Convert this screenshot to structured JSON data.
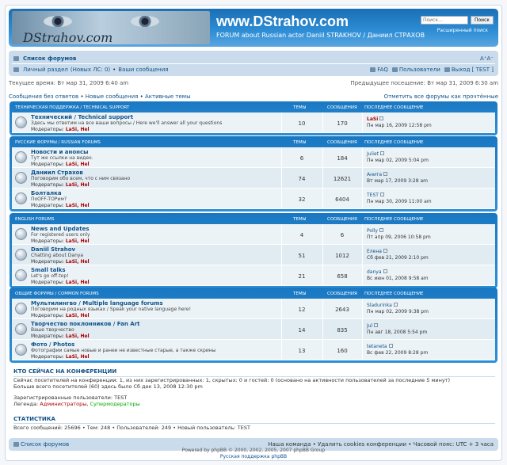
{
  "header": {
    "logo_text": "DStrahov.com",
    "site_name": "www.DStrahov.com",
    "site_desc": "FORUM about Russian actor Daniil STRAKHOV / Даниил СТРАХОВ",
    "search_placeholder": "Поиск…",
    "search_button": "Поиск",
    "advanced_search": "Расширенный поиск"
  },
  "navbar": {
    "forum_index": "Список форумов",
    "fontsize": "A⁺A⁻",
    "ucp": "Личный раздел",
    "pm": "(Новых ЛС: 0)",
    "pm_sep": "•",
    "own_posts": "Ваши сообщения",
    "faq": "FAQ",
    "members": "Пользователи",
    "logout": "Выход [ TEST ]"
  },
  "time": {
    "current": "Текущее время: Вт мар 31, 2009 6:40 am",
    "last_visit": "Предыдущее посещение: Вт мар 31, 2009 6:30 am"
  },
  "links": {
    "unanswered": "Сообщения без ответов",
    "sep": "•",
    "new_posts": "Новые сообщения",
    "active": "Активные темы",
    "mark_read": "Отметить все форумы как прочтённые"
  },
  "col_headers": {
    "topics": "ТЕМЫ",
    "posts": "СООБЩЕНИЯ",
    "last_post": "ПОСЛЕДНЕЕ СООБЩЕНИЕ"
  },
  "mods_label": "Модераторы:",
  "mods_list": "LaSi, Hel",
  "categories": [
    {
      "name": "ТЕХНИЧЕСКАЯ ПОДДЕРЖКА / TECHNICAL SUPPORT",
      "forums": [
        {
          "name": "Технический / Technical support",
          "desc": "Здесь мы ответим на все ваши вопросы / Here we'll answer all your questions",
          "topics": "10",
          "posts": "170",
          "last_user": "LaSi",
          "last_user_admin": true,
          "last_date": "Пн мар 16, 2009 12:58 pm"
        }
      ]
    },
    {
      "name": "РУССКИЕ ФОРУМЫ / RUSSIAN FORUMS",
      "forums": [
        {
          "name": "Новости и анонсы",
          "desc": "Тут же ссылки на видео.",
          "topics": "6",
          "posts": "184",
          "last_user": "Juliet",
          "last_user_admin": false,
          "last_date": "Пн мар 02, 2009 5:04 pm"
        },
        {
          "name": "Даниил Страхов",
          "desc": "Поговорим обо всем, что с ним связано",
          "topics": "74",
          "posts": "12621",
          "last_user": "Анита",
          "last_user_admin": false,
          "last_date": "Вт мар 17, 2009 3:28 am"
        },
        {
          "name": "Болталка",
          "desc": "ПоOFF-TOPим?",
          "topics": "32",
          "posts": "6404",
          "last_user": "TEST",
          "last_user_admin": false,
          "last_date": "Пн мар 30, 2009 11:00 am"
        }
      ]
    },
    {
      "name": "ENGLISH FORUMS",
      "forums": [
        {
          "name": "News and Updates",
          "desc": "For registered users only",
          "topics": "4",
          "posts": "6",
          "last_user": "Polly",
          "last_user_admin": false,
          "last_date": "Пт апр 09, 2006 10:58 pm"
        },
        {
          "name": "Daniil Strahov",
          "desc": "Chatting about Danya",
          "topics": "51",
          "posts": "1012",
          "last_user": "Елена",
          "last_user_admin": false,
          "last_date": "Сб фев 21, 2009 2:10 pm"
        },
        {
          "name": "Small talks",
          "desc": "Let's go off-top!",
          "topics": "21",
          "posts": "658",
          "last_user": "danya",
          "last_user_admin": false,
          "last_date": "Вс июн 01, 2008 9:58 am"
        }
      ]
    },
    {
      "name": "ОБЩИЕ ФОРУМЫ / COMMON FORUMS",
      "forums": [
        {
          "name": "Мультилингво / Multiple language forums",
          "desc": "Поговорим на родных языках / Speak your native language here!",
          "topics": "12",
          "posts": "2643",
          "last_user": "Sladurinka",
          "last_user_admin": false,
          "last_date": "Пн мар 02, 2009 9:38 pm"
        },
        {
          "name": "Творчество поклонников / Fan Art",
          "desc": "Ваше творчество",
          "topics": "14",
          "posts": "835",
          "last_user": "Jul",
          "last_user_admin": false,
          "last_date": "Пн авг 18, 2008 5:54 pm"
        },
        {
          "name": "Фото / Photos",
          "desc": "Фотографии самые новые и ранее не известные старые, а также скрины",
          "topics": "13",
          "posts": "160",
          "last_user": "tetaneta",
          "last_user_admin": false,
          "last_date": "Вс фев 22, 2009 8:28 pm"
        }
      ]
    }
  ],
  "online": {
    "title": "КТО СЕЙЧАС НА КОНФЕРЕНЦИИ",
    "line1": "Сейчас посетителей на конференции: 1, из них зарегистрированных: 1, скрытых: 0 и гостей: 0 (основано на активности пользователей за последние 5 минут)",
    "line2": "Больше всего посетителей (60) здесь было Сб дек 13, 2008 12:30 pm",
    "registered": "Зарегистрированные пользователи: TEST",
    "legend_label": "Легенда:",
    "legend_admins": "Администраторы",
    "legend_smods": "Супермодераторы"
  },
  "stats": {
    "title": "СТАТИСТИКА",
    "line": "Всего сообщений: 25696 • Тем: 248 • Пользователей: 249 • Новый пользователь: TEST"
  },
  "footer": {
    "index": "Список форумов",
    "right": "Наша команда • Удалить cookies конференции • Часовой пояс: UTC + 3 часа",
    "copy1": "Powered by phpBB © 2000, 2002, 2005, 2007 phpBB Group",
    "copy2": "Русская поддержка phpBB"
  }
}
